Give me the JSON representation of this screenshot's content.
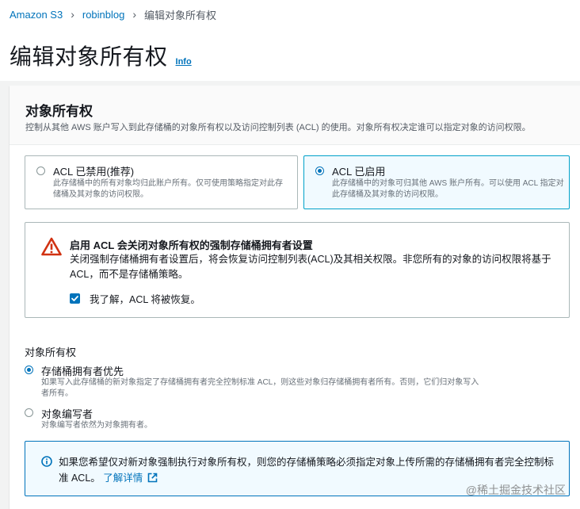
{
  "breadcrumb": {
    "items": [
      "Amazon S3",
      "robinblog"
    ],
    "current": "编辑对象所有权"
  },
  "header": {
    "title": "编辑对象所有权",
    "info_label": "Info"
  },
  "panel": {
    "title": "对象所有权",
    "description": "控制从其他 AWS 账户写入到此存储桶的对象所有权以及访问控制列表 (ACL) 的使用。对象所有权决定谁可以指定对象的访问权限。",
    "tiles": [
      {
        "title": "ACL 已禁用(推荐)",
        "description": "此存储桶中的所有对象均归此账户所有。仅可使用策略指定对此存储桶及其对象的访问权限。",
        "selected": false
      },
      {
        "title": "ACL 已启用",
        "description": "此存储桶中的对象可归其他 AWS 账户所有。可以使用 ACL 指定对此存储桶及其对象的访问权限。",
        "selected": true
      }
    ]
  },
  "warning": {
    "title": "启用 ACL 会关闭对象所有权的强制存储桶拥有者设置",
    "body": "关闭强制存储桶拥有者设置后，将会恢复访问控制列表(ACL)及其相关权限。非您所有的对象的访问权限将基于 ACL，而不是存储桶策略。",
    "acknowledge_label": "我了解，ACL 将被恢复。",
    "acknowledged": true
  },
  "ownership": {
    "label": "对象所有权",
    "options": [
      {
        "title": "存储桶拥有者优先",
        "description": "如果写入此存储桶的新对象指定了存储桶拥有者完全控制标准 ACL，则这些对象归存储桶拥有者所有。否则，它们归对象写入者所有。",
        "selected": true
      },
      {
        "title": "对象编写者",
        "description": "对象编写者依然为对象拥有者。",
        "selected": false
      }
    ]
  },
  "info_alert": {
    "text": "如果您希望仅对新对象强制执行对象所有权，则您的存储桶策略必须指定对象上传所需的存储桶拥有者完全控制标准 ACL。",
    "link_label": "了解详情"
  },
  "watermark": "@稀土掘金技术社区",
  "colors": {
    "link": "#0073bb",
    "selected_border": "#00a1c9",
    "warning_red": "#d13212",
    "info_blue": "#0073bb"
  }
}
